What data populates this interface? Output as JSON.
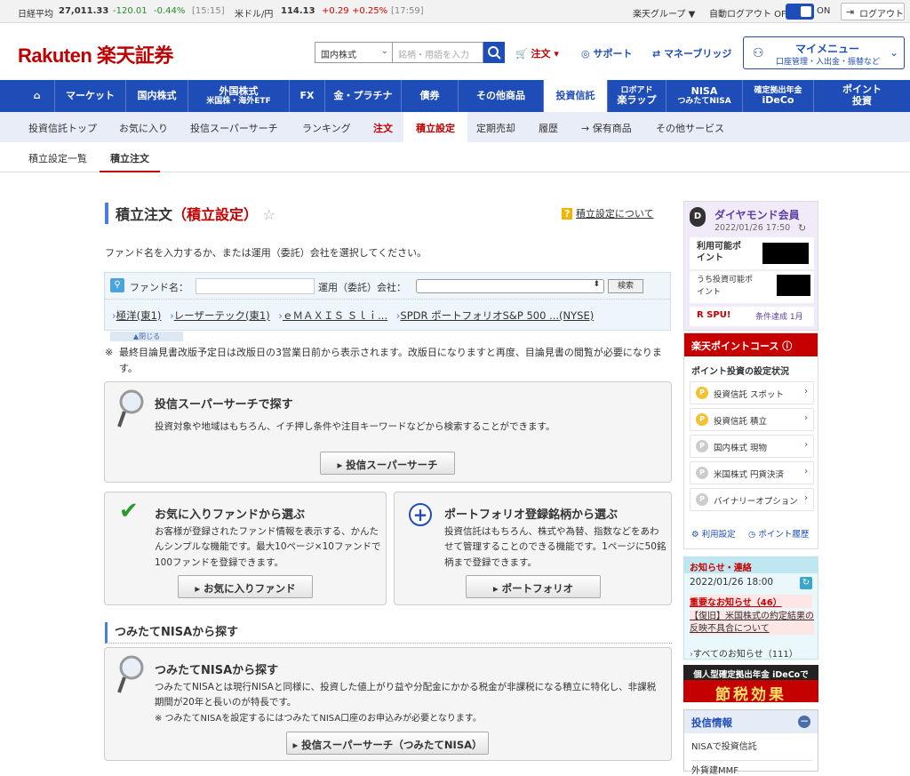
{
  "ticker": {
    "nikkei_label": "日経平均",
    "nikkei_value": "27,011.33",
    "nikkei_change": "-120.01",
    "nikkei_pct": "-0.44%",
    "nikkei_time": "[15:15]",
    "usd_label": "米ドル/円",
    "usd_value": "114.13",
    "usd_change": "+0.29",
    "usd_pct": "+0.25%",
    "usd_time": "[17:59]",
    "group": "楽天グループ ▼",
    "autologout": "自動ログアウト OFF",
    "on": "ON",
    "logout": "ログアウト"
  },
  "header": {
    "logo": "Rakuten 楽天証券",
    "search_select": "国内株式",
    "search_placeholder": "銘柄・用語を入力",
    "order": "注文 ▾",
    "support": "サポート",
    "money_bridge": "マネーブリッジ",
    "mymenu_title": "マイメニュー",
    "mymenu_sub": "口座管理・入出金・振替など"
  },
  "mainnav": [
    "マーケット",
    "国内株式",
    "外国株式",
    "米国株・海外ETF",
    "FX",
    "金・プラチナ",
    "債券",
    "その他商品",
    "投資信託",
    "ロボアド",
    "楽ラップ",
    "NISA",
    "つみたてNISA",
    "確定拠出年金",
    "iDeCo",
    "ポイント",
    "投資"
  ],
  "subnav": [
    "投資信託トップ",
    "お気に入り",
    "投信スーパーサーチ",
    "ランキング",
    "注文",
    "積立設定",
    "定期売却",
    "履歴",
    "→ 保有商品",
    "その他サービス"
  ],
  "subnav2": [
    "積立設定一覧",
    "積立注文"
  ],
  "page": {
    "title": "積立注文",
    "title_red": "（積立設定）",
    "help": "積立設定について",
    "desc": "ファンド名を入力するか、または運用（委託）会社を選択してください。"
  },
  "search": {
    "fund_label": "ファンド名：",
    "company_label": "運用（委託）会社：",
    "button": "検索",
    "recent": [
      "極洋(東1)",
      "レーザーテック(東1)",
      "ｅＭＡＸＩＳ Ｓｌｉ...",
      "SPDR ポートフォリオS&P 500 ...(NYSE)"
    ],
    "close": "▲閉じる",
    "note": "最終目論見書改版予定日は改版日の3営業日前から表示されます。改版日になりますと再度、目論見書の閲覧が必要になります。"
  },
  "panels": {
    "super_title": "投信スーパーサーチで探す",
    "super_text": "投資対象や地域はもちろん、イチ押し条件や注目キーワードなどから検索することができます。",
    "super_btn": "▸ 投信スーパーサーチ",
    "fav_title": "お気に入りファンドから選ぶ",
    "fav_text": "お客様が登録されたファンド情報を表示する、かんたんシンプルな機能です。最大10ページ×10ファンドで100ファンドを登録できます。",
    "fav_btn": "▸ お気に入りファンド",
    "pf_title": "ポートフォリオ登録銘柄から選ぶ",
    "pf_text": "投資信託はもちろん、株式や為替、指数などをあわせて管理することのできる機能です。1ページに50銘柄まで登録できます。",
    "pf_btn": "▸ ポートフォリオ",
    "nisa_section": "つみたてNISAから探す",
    "nisa_title": "つみたてNISAから探す",
    "nisa_text": "つみたてNISAとは現行NISAと同様に、投資した値上がり益や分配金にかかる税金が非課税になる積立に特化し、非課税期間が20年と長いのが特長です。",
    "nisa_note": "※ つみたてNISAを設定するにはつみたてNISA口座のお申込みが必要となります。",
    "nisa_btn": "▸ 投信スーパーサーチ（つみたてNISA）"
  },
  "side": {
    "rank": "ダイヤモンド会員",
    "date": "2022/01/26 17:50",
    "points_label": "利用可能ポイント",
    "invest_label": "うち投資可能ポイント",
    "spu": "R SPU!",
    "spu_cond": "条件達成 1月",
    "course": "楽天ポイントコース",
    "setting": "ポイント投資の設定状況",
    "rows": [
      "投資信託 スポット",
      "投資信託 積立",
      "国内株式 現物",
      "米国株式 円貨決済",
      "バイナリーオプション"
    ],
    "use_setting": "利用設定",
    "history": "ポイント履歴",
    "news_title": "お知らせ・連絡",
    "news_date": "2022/01/26 18:00",
    "important": "重要なお知らせ（46）",
    "news_item": "【復旧】米国株式の約定結果の反映不具合について",
    "all_news": "すべてのお知らせ（111）",
    "ad_top": "個人型確定拠出年金 iDeCoで",
    "ad_main": "節税効果",
    "info_title": "投信情報",
    "info_1": "NISAで投資信託",
    "info_2": "外貨建MMF"
  }
}
